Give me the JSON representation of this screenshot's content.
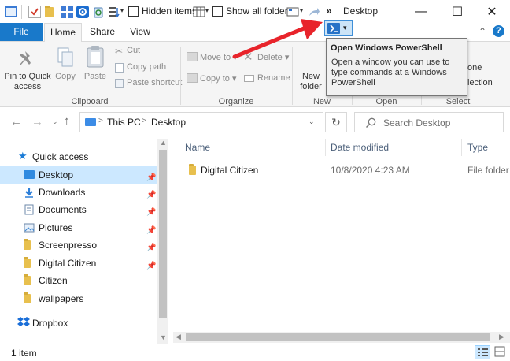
{
  "window": {
    "title": "Desktop",
    "controls": {
      "minimize": "—",
      "maximize": "☐",
      "close": "✕"
    }
  },
  "qat": {
    "hidden_items": "Hidden items",
    "show_all_folders": "Show all folders",
    "more": "»"
  },
  "tabs": {
    "file": "File",
    "home": "Home",
    "share": "Share",
    "view": "View"
  },
  "ribbon": {
    "clipboard": {
      "pin": "Pin to Quick access",
      "copy": "Copy",
      "paste": "Paste",
      "cut": "Cut",
      "copy_path": "Copy path",
      "paste_shortcut": "Paste shortcut",
      "label": "Clipboard"
    },
    "organize": {
      "move_to": "Move to",
      "copy_to": "Copy to",
      "delete": "Delete",
      "rename": "Rename",
      "label": "Organize"
    },
    "new": {
      "new_folder": "New folder",
      "label": "New"
    },
    "open": {
      "label": "Open"
    },
    "select": {
      "partial_1": "one",
      "partial_2": "lection",
      "label": "Select"
    }
  },
  "tooltip": {
    "title": "Open Windows PowerShell",
    "body": "Open a window you can use to type commands at a Windows PowerShell"
  },
  "address": {
    "crumbs": [
      "This PC",
      "Desktop"
    ],
    "separator": ">",
    "search_placeholder": "Search Desktop"
  },
  "sidebar": {
    "quick_access": "Quick access",
    "items": [
      {
        "label": "Desktop",
        "icon": "desktop-icon",
        "pinned": true,
        "selected": true
      },
      {
        "label": "Downloads",
        "icon": "download-icon",
        "pinned": true
      },
      {
        "label": "Documents",
        "icon": "document-icon",
        "pinned": true
      },
      {
        "label": "Pictures",
        "icon": "picture-icon",
        "pinned": true
      },
      {
        "label": "Screenpresso",
        "icon": "folder-icon",
        "pinned": true
      },
      {
        "label": "Digital Citizen",
        "icon": "folder-icon",
        "pinned": true
      },
      {
        "label": "Citizen",
        "icon": "folder-icon",
        "pinned": false
      },
      {
        "label": "wallpapers",
        "icon": "folder-icon",
        "pinned": false
      }
    ],
    "dropbox": "Dropbox"
  },
  "content": {
    "columns": {
      "name": "Name",
      "date": "Date modified",
      "type": "Type"
    },
    "rows": [
      {
        "name": "Digital Citizen",
        "date": "10/8/2020 4:23 AM",
        "type": "File folder"
      }
    ]
  },
  "status": {
    "count": "1 item"
  },
  "colors": {
    "accent": "#1979ca",
    "arrow": "#e8242b",
    "tooltip_bg": "#f1f1f1"
  }
}
